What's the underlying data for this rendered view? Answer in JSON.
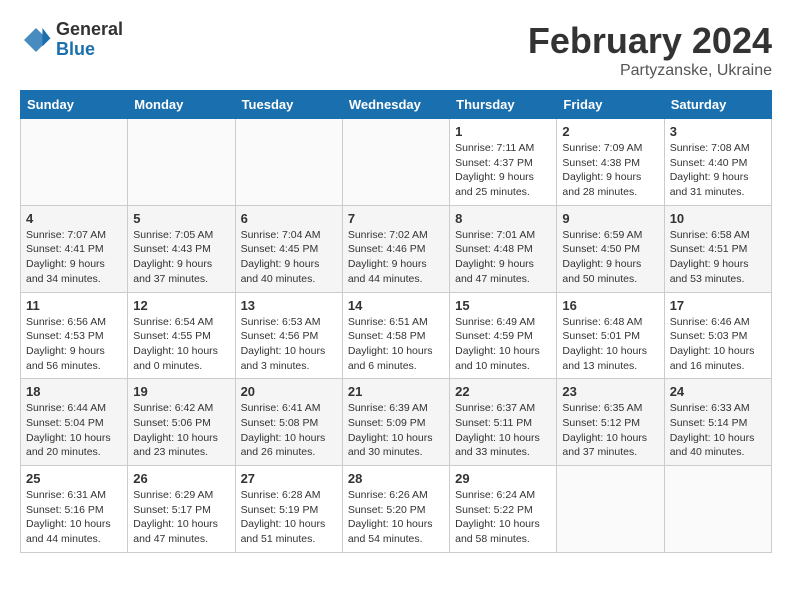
{
  "header": {
    "logo_general": "General",
    "logo_blue": "Blue",
    "title": "February 2024",
    "subtitle": "Partyzanske, Ukraine"
  },
  "weekdays": [
    "Sunday",
    "Monday",
    "Tuesday",
    "Wednesday",
    "Thursday",
    "Friday",
    "Saturday"
  ],
  "weeks": [
    [
      {
        "day": "",
        "info": ""
      },
      {
        "day": "",
        "info": ""
      },
      {
        "day": "",
        "info": ""
      },
      {
        "day": "",
        "info": ""
      },
      {
        "day": "1",
        "info": "Sunrise: 7:11 AM\nSunset: 4:37 PM\nDaylight: 9 hours\nand 25 minutes."
      },
      {
        "day": "2",
        "info": "Sunrise: 7:09 AM\nSunset: 4:38 PM\nDaylight: 9 hours\nand 28 minutes."
      },
      {
        "day": "3",
        "info": "Sunrise: 7:08 AM\nSunset: 4:40 PM\nDaylight: 9 hours\nand 31 minutes."
      }
    ],
    [
      {
        "day": "4",
        "info": "Sunrise: 7:07 AM\nSunset: 4:41 PM\nDaylight: 9 hours\nand 34 minutes."
      },
      {
        "day": "5",
        "info": "Sunrise: 7:05 AM\nSunset: 4:43 PM\nDaylight: 9 hours\nand 37 minutes."
      },
      {
        "day": "6",
        "info": "Sunrise: 7:04 AM\nSunset: 4:45 PM\nDaylight: 9 hours\nand 40 minutes."
      },
      {
        "day": "7",
        "info": "Sunrise: 7:02 AM\nSunset: 4:46 PM\nDaylight: 9 hours\nand 44 minutes."
      },
      {
        "day": "8",
        "info": "Sunrise: 7:01 AM\nSunset: 4:48 PM\nDaylight: 9 hours\nand 47 minutes."
      },
      {
        "day": "9",
        "info": "Sunrise: 6:59 AM\nSunset: 4:50 PM\nDaylight: 9 hours\nand 50 minutes."
      },
      {
        "day": "10",
        "info": "Sunrise: 6:58 AM\nSunset: 4:51 PM\nDaylight: 9 hours\nand 53 minutes."
      }
    ],
    [
      {
        "day": "11",
        "info": "Sunrise: 6:56 AM\nSunset: 4:53 PM\nDaylight: 9 hours\nand 56 minutes."
      },
      {
        "day": "12",
        "info": "Sunrise: 6:54 AM\nSunset: 4:55 PM\nDaylight: 10 hours\nand 0 minutes."
      },
      {
        "day": "13",
        "info": "Sunrise: 6:53 AM\nSunset: 4:56 PM\nDaylight: 10 hours\nand 3 minutes."
      },
      {
        "day": "14",
        "info": "Sunrise: 6:51 AM\nSunset: 4:58 PM\nDaylight: 10 hours\nand 6 minutes."
      },
      {
        "day": "15",
        "info": "Sunrise: 6:49 AM\nSunset: 4:59 PM\nDaylight: 10 hours\nand 10 minutes."
      },
      {
        "day": "16",
        "info": "Sunrise: 6:48 AM\nSunset: 5:01 PM\nDaylight: 10 hours\nand 13 minutes."
      },
      {
        "day": "17",
        "info": "Sunrise: 6:46 AM\nSunset: 5:03 PM\nDaylight: 10 hours\nand 16 minutes."
      }
    ],
    [
      {
        "day": "18",
        "info": "Sunrise: 6:44 AM\nSunset: 5:04 PM\nDaylight: 10 hours\nand 20 minutes."
      },
      {
        "day": "19",
        "info": "Sunrise: 6:42 AM\nSunset: 5:06 PM\nDaylight: 10 hours\nand 23 minutes."
      },
      {
        "day": "20",
        "info": "Sunrise: 6:41 AM\nSunset: 5:08 PM\nDaylight: 10 hours\nand 26 minutes."
      },
      {
        "day": "21",
        "info": "Sunrise: 6:39 AM\nSunset: 5:09 PM\nDaylight: 10 hours\nand 30 minutes."
      },
      {
        "day": "22",
        "info": "Sunrise: 6:37 AM\nSunset: 5:11 PM\nDaylight: 10 hours\nand 33 minutes."
      },
      {
        "day": "23",
        "info": "Sunrise: 6:35 AM\nSunset: 5:12 PM\nDaylight: 10 hours\nand 37 minutes."
      },
      {
        "day": "24",
        "info": "Sunrise: 6:33 AM\nSunset: 5:14 PM\nDaylight: 10 hours\nand 40 minutes."
      }
    ],
    [
      {
        "day": "25",
        "info": "Sunrise: 6:31 AM\nSunset: 5:16 PM\nDaylight: 10 hours\nand 44 minutes."
      },
      {
        "day": "26",
        "info": "Sunrise: 6:29 AM\nSunset: 5:17 PM\nDaylight: 10 hours\nand 47 minutes."
      },
      {
        "day": "27",
        "info": "Sunrise: 6:28 AM\nSunset: 5:19 PM\nDaylight: 10 hours\nand 51 minutes."
      },
      {
        "day": "28",
        "info": "Sunrise: 6:26 AM\nSunset: 5:20 PM\nDaylight: 10 hours\nand 54 minutes."
      },
      {
        "day": "29",
        "info": "Sunrise: 6:24 AM\nSunset: 5:22 PM\nDaylight: 10 hours\nand 58 minutes."
      },
      {
        "day": "",
        "info": ""
      },
      {
        "day": "",
        "info": ""
      }
    ]
  ]
}
